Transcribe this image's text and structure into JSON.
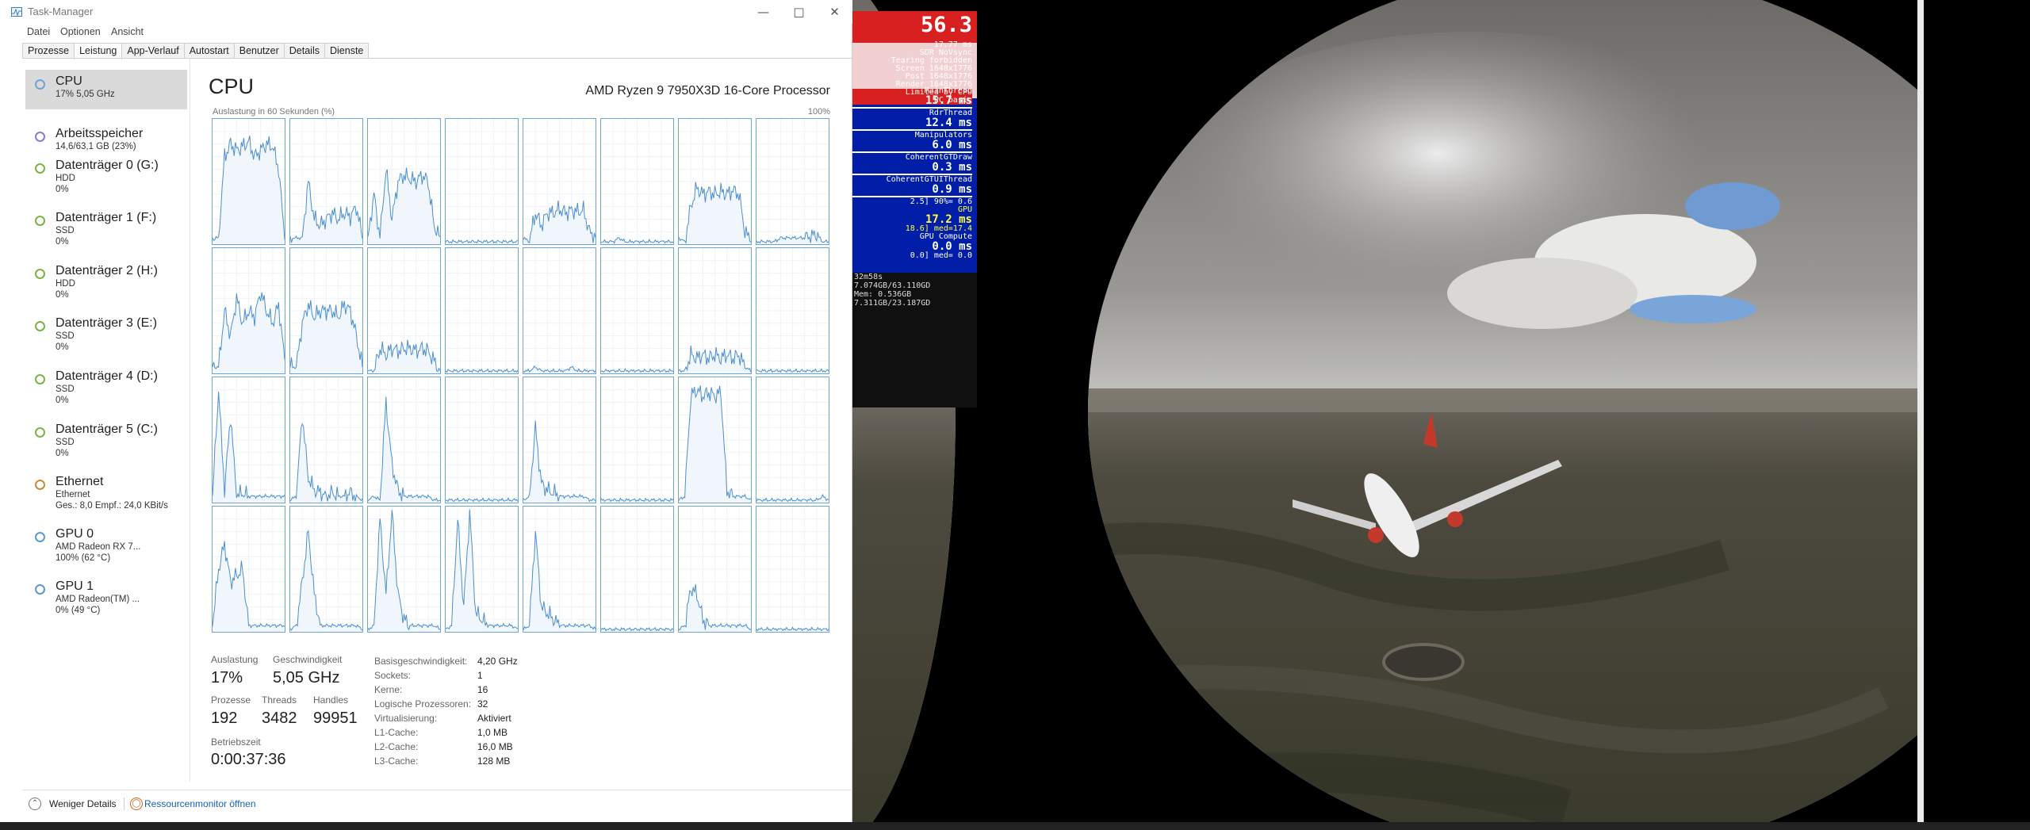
{
  "window": {
    "title": "Task-Manager"
  },
  "menu": [
    "Datei",
    "Optionen",
    "Ansicht"
  ],
  "tabs": [
    "Prozesse",
    "Leistung",
    "App-Verlauf",
    "Autostart",
    "Benutzer",
    "Details",
    "Dienste"
  ],
  "active_tab": "Leistung",
  "sidebar": [
    {
      "name": "CPU",
      "lines": [
        "17% 5,05 GHz"
      ],
      "ring_color": "#6ea4d8",
      "selected": true
    },
    {
      "name": "Arbeitsspeicher",
      "lines": [
        "14,6/63,1 GB (23%)"
      ],
      "ring_color": "#8a7bd8"
    },
    {
      "name": "Datenträger 0 (G:)",
      "lines": [
        "HDD",
        "0%"
      ],
      "ring_color": "#7cb342"
    },
    {
      "name": "Datenträger 1 (F:)",
      "lines": [
        "SSD",
        "0%"
      ],
      "ring_color": "#7cb342"
    },
    {
      "name": "Datenträger 2 (H:)",
      "lines": [
        "HDD",
        "0%"
      ],
      "ring_color": "#7cb342"
    },
    {
      "name": "Datenträger 3 (E:)",
      "lines": [
        "SSD",
        "0%"
      ],
      "ring_color": "#7cb342"
    },
    {
      "name": "Datenträger 4 (D:)",
      "lines": [
        "SSD",
        "0%"
      ],
      "ring_color": "#7cb342"
    },
    {
      "name": "Datenträger 5 (C:)",
      "lines": [
        "SSD",
        "0%"
      ],
      "ring_color": "#7cb342"
    },
    {
      "name": "Ethernet",
      "lines": [
        "Ethernet",
        "Ges.: 8,0 Empf.: 24,0 KBit/s"
      ],
      "ring_color": "#d08a3a"
    },
    {
      "name": "GPU 0",
      "lines": [
        "AMD Radeon RX 7...",
        "100% (62 °C)"
      ],
      "ring_color": "#5b9bd5"
    },
    {
      "name": "GPU 1",
      "lines": [
        "AMD Radeon(TM) ...",
        "0% (49 °C)"
      ],
      "ring_color": "#5b9bd5"
    }
  ],
  "main": {
    "title": "CPU",
    "model": "AMD Ryzen 9 7950X3D 16-Core Processor",
    "util_caption": "Auslastung in 60 Sekunden (%)",
    "max_caption": "100%"
  },
  "stats": {
    "auslastung_label": "Auslastung",
    "auslastung": "17%",
    "geschw_label": "Geschwindigkeit",
    "geschw": "5,05 GHz",
    "prozesse_label": "Prozesse",
    "prozesse": "192",
    "threads_label": "Threads",
    "threads": "3482",
    "handles_label": "Handles",
    "handles": "99951",
    "betriebszeit_label": "Betriebszeit",
    "betriebszeit": "0:00:37:36"
  },
  "info": [
    {
      "k": "Basisgeschwindigkeit:",
      "v": "4,20 GHz"
    },
    {
      "k": "Sockets:",
      "v": "1"
    },
    {
      "k": "Kerne:",
      "v": "16"
    },
    {
      "k": "Logische Prozessoren:",
      "v": "32"
    },
    {
      "k": "Virtualisierung:",
      "v": "Aktiviert"
    },
    {
      "k": "L1-Cache:",
      "v": "1,0 MB"
    },
    {
      "k": "L2-Cache:",
      "v": "16,0 MB"
    },
    {
      "k": "L3-Cache:",
      "v": "128 MB"
    }
  ],
  "bottom": {
    "less": "Weniger Details",
    "resmon": "Ressourcenmonitor öffnen"
  },
  "cpu_graph_profiles": [
    [
      0.05,
      0.05,
      0.7,
      0.8,
      0.75,
      0.78,
      0.82,
      0.7,
      0.75,
      0.8,
      0.78,
      0.6,
      0.05
    ],
    [
      0.05,
      0.05,
      0.05,
      0.5,
      0.2,
      0.15,
      0.2,
      0.25,
      0.2,
      0.25,
      0.22,
      0.3,
      0.05
    ],
    [
      0.05,
      0.4,
      0.05,
      0.6,
      0.2,
      0.5,
      0.55,
      0.52,
      0.5,
      0.55,
      0.5,
      0.15,
      0.05
    ],
    [
      0.02,
      0.02,
      0.02,
      0.02,
      0.02,
      0.02,
      0.02,
      0.02,
      0.02,
      0.02,
      0.02,
      0.02,
      0.02
    ],
    [
      0.05,
      0.02,
      0.25,
      0.15,
      0.25,
      0.25,
      0.28,
      0.25,
      0.27,
      0.26,
      0.27,
      0.1,
      0.05
    ],
    [
      0.02,
      0.02,
      0.02,
      0.05,
      0.02,
      0.02,
      0.02,
      0.02,
      0.02,
      0.02,
      0.02,
      0.02,
      0.02
    ],
    [
      0.05,
      0.02,
      0.3,
      0.45,
      0.4,
      0.42,
      0.4,
      0.42,
      0.4,
      0.43,
      0.4,
      0.1,
      0.02
    ],
    [
      0.02,
      0.02,
      0.02,
      0.02,
      0.05,
      0.05,
      0.05,
      0.05,
      0.05,
      0.06,
      0.08,
      0.02,
      0.02
    ],
    [
      0.05,
      0.05,
      0.5,
      0.3,
      0.6,
      0.4,
      0.5,
      0.45,
      0.65,
      0.5,
      0.4,
      0.55,
      0.1
    ],
    [
      0.05,
      0.05,
      0.4,
      0.55,
      0.45,
      0.5,
      0.5,
      0.5,
      0.45,
      0.55,
      0.5,
      0.3,
      0.05
    ],
    [
      0.02,
      0.02,
      0.2,
      0.15,
      0.2,
      0.18,
      0.2,
      0.2,
      0.18,
      0.2,
      0.18,
      0.1,
      0.02
    ],
    [
      0.02,
      0.02,
      0.02,
      0.02,
      0.02,
      0.02,
      0.02,
      0.02,
      0.02,
      0.02,
      0.02,
      0.02,
      0.02
    ],
    [
      0.02,
      0.02,
      0.05,
      0.02,
      0.02,
      0.02,
      0.02,
      0.02,
      0.05,
      0.02,
      0.02,
      0.02,
      0.02
    ],
    [
      0.02,
      0.02,
      0.02,
      0.02,
      0.02,
      0.02,
      0.02,
      0.02,
      0.02,
      0.02,
      0.02,
      0.02,
      0.02
    ],
    [
      0.02,
      0.02,
      0.15,
      0.12,
      0.15,
      0.12,
      0.15,
      0.12,
      0.15,
      0.12,
      0.15,
      0.05,
      0.02
    ],
    [
      0.02,
      0.02,
      0.02,
      0.02,
      0.02,
      0.02,
      0.02,
      0.02,
      0.02,
      0.02,
      0.02,
      0.02,
      0.02
    ],
    [
      0.05,
      0.9,
      0.1,
      0.7,
      0.05,
      0.08,
      0.05,
      0.05,
      0.05,
      0.05,
      0.05,
      0.05,
      0.05
    ],
    [
      0.02,
      0.05,
      0.7,
      0.2,
      0.1,
      0.08,
      0.05,
      0.08,
      0.05,
      0.05,
      0.08,
      0.05,
      0.02
    ],
    [
      0.02,
      0.05,
      0.02,
      0.8,
      0.3,
      0.1,
      0.05,
      0.05,
      0.05,
      0.05,
      0.05,
      0.02,
      0.02
    ],
    [
      0.02,
      0.02,
      0.02,
      0.02,
      0.02,
      0.02,
      0.02,
      0.02,
      0.02,
      0.02,
      0.02,
      0.02,
      0.02
    ],
    [
      0.02,
      0.05,
      0.6,
      0.15,
      0.1,
      0.08,
      0.05,
      0.05,
      0.05,
      0.05,
      0.05,
      0.02,
      0.02
    ],
    [
      0.02,
      0.02,
      0.02,
      0.02,
      0.02,
      0.02,
      0.02,
      0.02,
      0.02,
      0.02,
      0.02,
      0.02,
      0.02
    ],
    [
      0.02,
      0.05,
      0.85,
      0.9,
      0.85,
      0.88,
      0.85,
      0.88,
      0.1,
      0.05,
      0.05,
      0.05,
      0.02
    ],
    [
      0.02,
      0.02,
      0.02,
      0.02,
      0.02,
      0.02,
      0.02,
      0.02,
      0.02,
      0.02,
      0.02,
      0.05,
      0.02
    ],
    [
      0.05,
      0.5,
      0.7,
      0.4,
      0.45,
      0.5,
      0.05,
      0.05,
      0.05,
      0.05,
      0.05,
      0.05,
      0.05
    ],
    [
      0.02,
      0.05,
      0.4,
      0.8,
      0.3,
      0.05,
      0.05,
      0.05,
      0.05,
      0.05,
      0.05,
      0.05,
      0.02
    ],
    [
      0.02,
      0.05,
      0.9,
      0.3,
      0.95,
      0.3,
      0.1,
      0.05,
      0.05,
      0.05,
      0.05,
      0.05,
      0.02
    ],
    [
      0.02,
      0.05,
      0.9,
      0.2,
      0.95,
      0.15,
      0.1,
      0.05,
      0.05,
      0.05,
      0.05,
      0.05,
      0.02
    ],
    [
      0.02,
      0.05,
      0.8,
      0.2,
      0.15,
      0.1,
      0.05,
      0.05,
      0.05,
      0.05,
      0.05,
      0.05,
      0.02
    ],
    [
      0.02,
      0.02,
      0.02,
      0.02,
      0.02,
      0.02,
      0.02,
      0.02,
      0.02,
      0.02,
      0.02,
      0.02,
      0.02
    ],
    [
      0.02,
      0.05,
      0.35,
      0.3,
      0.1,
      0.05,
      0.05,
      0.05,
      0.05,
      0.05,
      0.05,
      0.05,
      0.02
    ],
    [
      0.02,
      0.02,
      0.02,
      0.02,
      0.02,
      0.02,
      0.02,
      0.02,
      0.02,
      0.02,
      0.02,
      0.02,
      0.02
    ]
  ],
  "overlay": {
    "fps": "56.3",
    "frame_ms": "17.77 ms",
    "lines_top": [
      "SDR NoVsync",
      "Tearing forbidden",
      "Screen 1648x1776",
      "Post 1648x1776",
      "Render 1648x1776"
    ],
    "limited": "Limited by CPU",
    "limited_sub": "PC basic",
    "rows": [
      {
        "label": "MainThread",
        "value": "15.7 ms"
      },
      {
        "label": "RdrThread",
        "value": "12.4 ms"
      },
      {
        "label": "Manipulators",
        "value": "6.0 ms"
      },
      {
        "label": "CoherentGTDraw",
        "value": "0.3 ms"
      },
      {
        "label": "CoherentGTUIThread",
        "value": "0.9 ms"
      }
    ],
    "cohere_extra": "2.5] 90%= 0.6",
    "gpu_label": "GPU",
    "gpu_value": "17.2 ms",
    "gpu_extra": "18.6] med=17.4",
    "gpu_compute_label": "GPU Compute",
    "gpu_compute_value": "0.0 ms",
    "gpu_compute_extra": "0.0] med= 0.0",
    "mem": [
      "32m58s",
      "7.074GB/63.110GD",
      "Mem: 0.536GB",
      "7.311GB/23.187GD"
    ]
  }
}
